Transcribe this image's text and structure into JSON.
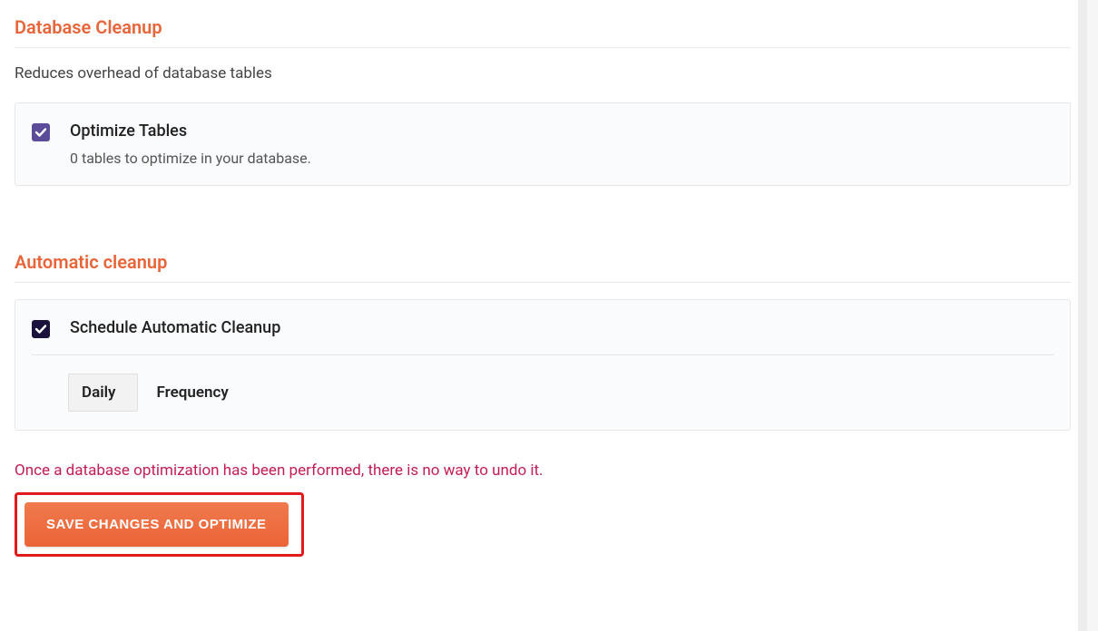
{
  "database_cleanup": {
    "title": "Database Cleanup",
    "description": "Reduces overhead of database tables",
    "optimize_tables": {
      "label": "Optimize Tables",
      "sub": "0 tables to optimize in your database.",
      "checked": true
    }
  },
  "automatic_cleanup": {
    "title": "Automatic cleanup",
    "schedule": {
      "label": "Schedule Automatic Cleanup",
      "checked": true
    },
    "frequency": {
      "selected": "Daily",
      "label": "Frequency"
    }
  },
  "warning": "Once a database optimization has been performed, there is no way to undo it.",
  "save_button": "SAVE CHANGES AND OPTIMIZE"
}
